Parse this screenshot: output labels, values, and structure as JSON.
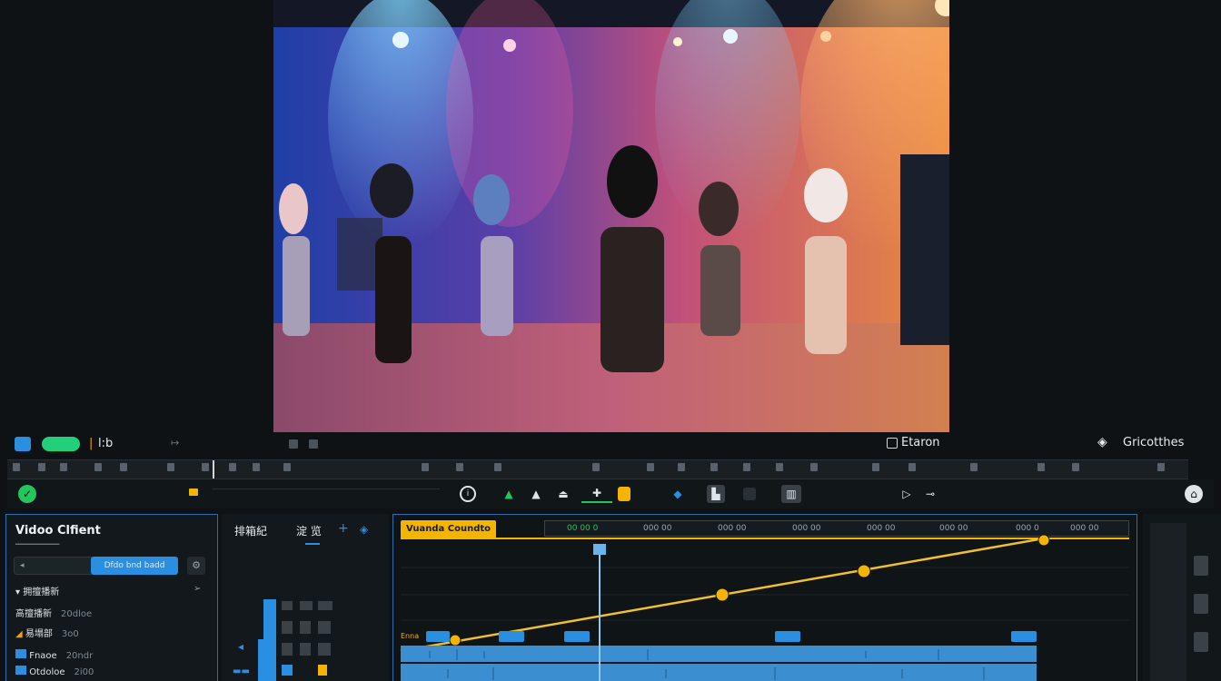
{
  "preview": {
    "content": "stage-dance-scene"
  },
  "transport": {
    "frame_label": "l:b",
    "right_label": "Etaron",
    "far_right_label": "Gricotthes"
  },
  "toolbar": {
    "accent": "#22c55e"
  },
  "left_panel": {
    "title": "Vidoo Clfient",
    "button_label": "Dfdo bnd badd",
    "rows": [
      {
        "label": "拥擅播新",
        "value": ""
      },
      {
        "label": "高擅播新",
        "value": "20dloe"
      },
      {
        "label": "易塌部",
        "value": "3o0"
      },
      {
        "label": "Fnaoe",
        "value": "20ndr"
      },
      {
        "label": "Otdoloe",
        "value": "2i00"
      }
    ]
  },
  "mid_panel": {
    "header_left": "排箱紀",
    "header_right": "淀 览"
  },
  "timeline": {
    "label": "Vuanda Coundto",
    "markers": [
      "00 00 0",
      "000 00",
      "000 00",
      "000 00",
      "000 00",
      "000 00",
      "000 0",
      "000 00"
    ],
    "track_label": "Enna",
    "accent": "#f5b400",
    "playhead": "#3a9bd9"
  }
}
